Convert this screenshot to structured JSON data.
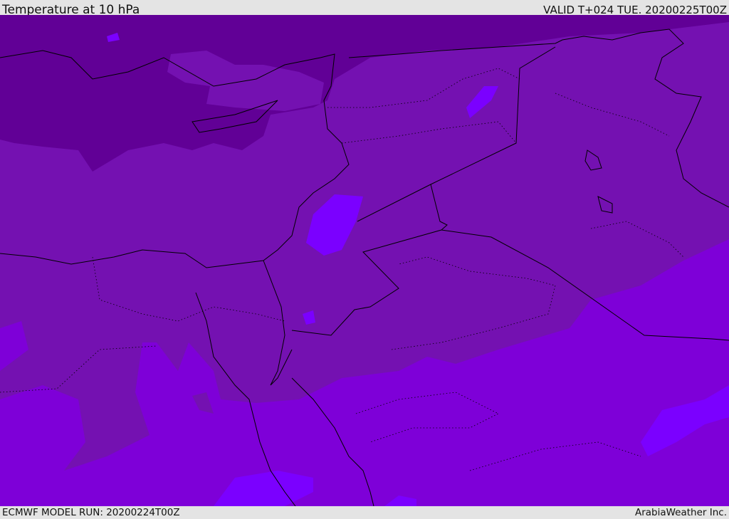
{
  "header": {
    "title": "Temperature at 10 hPa",
    "valid": "VALID T+024 TUE. 20200225T00Z"
  },
  "footer": {
    "model_run": "ECMWF MODEL RUN: 20200224T00Z",
    "credit": "ArabiaWeather Inc."
  },
  "map": {
    "variable": "Temperature",
    "level": "10 hPa",
    "colors": {
      "band_coldest": "#610096",
      "band_cold": "#7411b1",
      "band_mid": "#7e00d8",
      "band_warm": "#7b00ff",
      "coastline": "#000000"
    }
  }
}
